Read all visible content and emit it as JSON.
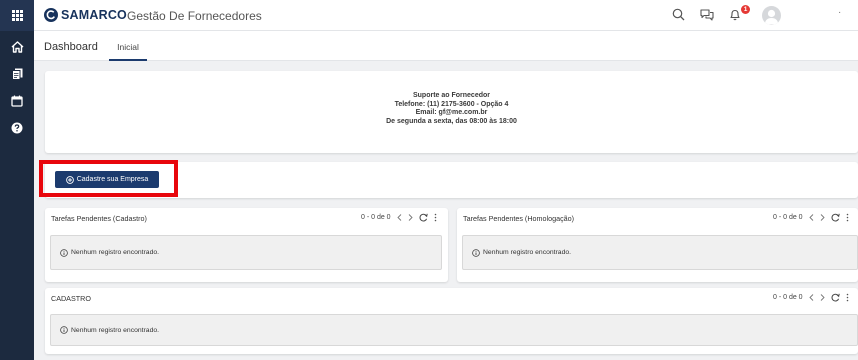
{
  "sidebar": {
    "items": [
      {
        "icon": "apps-grid-icon"
      },
      {
        "icon": "home-icon"
      },
      {
        "icon": "documents-icon"
      },
      {
        "icon": "calendar-icon"
      },
      {
        "icon": "help-icon"
      }
    ]
  },
  "header": {
    "logo_text": "SAMARCO",
    "app_title": "Gestão De Fornecedores",
    "notification_count": "1",
    "overflow": "·"
  },
  "tabs": {
    "dashboard": "Dashboard",
    "inicial": "Inicial"
  },
  "support": {
    "line1": "Suporte ao Fornecedor",
    "line2": "Telefone: (11) 2175-3600 - Opção 4",
    "line3": "Email: gf@me.com.br",
    "line4": "De segunda a sexta, das 08:00 às 18:00"
  },
  "register_button": {
    "label": "Cadastre sua Empresa"
  },
  "panels": {
    "cadastro_pending": {
      "title": "Tarefas Pendentes (Cadastro)",
      "pager": "0 - 0 de 0",
      "empty": "Nenhum registro encontrado."
    },
    "homologacao_pending": {
      "title": "Tarefas Pendentes (Homologação)",
      "pager": "0 - 0 de 0",
      "empty": "Nenhum registro encontrado."
    },
    "cadastro": {
      "title": "CADASTRO",
      "pager": "0 - 0 de 0",
      "empty": "Nenhum registro encontrado."
    }
  },
  "colors": {
    "sidebar": "#1c2a3f",
    "primary": "#1c3b6e",
    "highlight": "#e8060c",
    "badge": "#e53935"
  }
}
